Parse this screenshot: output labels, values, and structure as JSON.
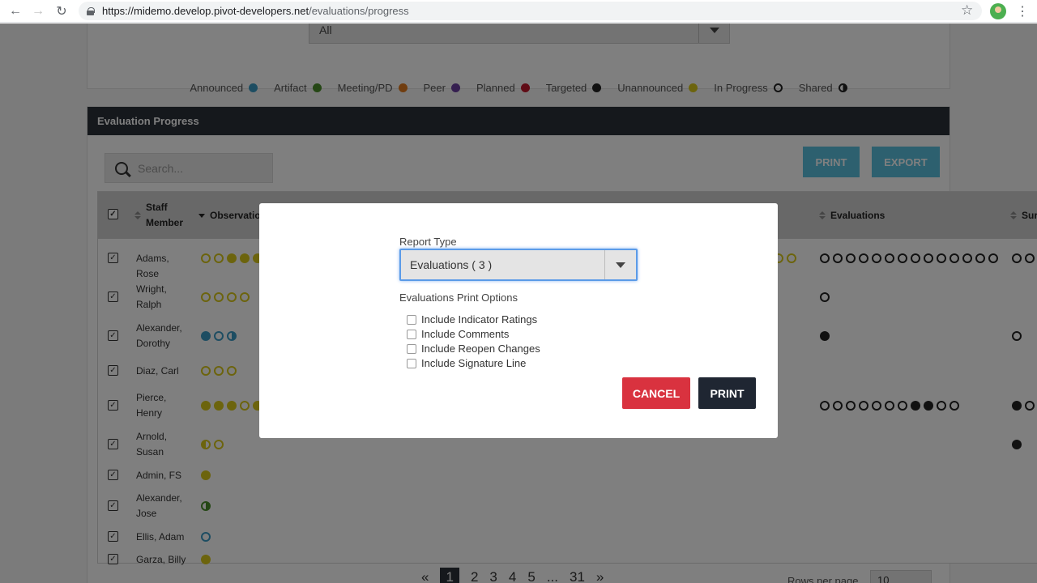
{
  "browser": {
    "url_host": "https://midemo.develop.pivot-developers.net",
    "url_path": "/evaluations/progress",
    "back_icon": "←",
    "forward_icon": "→",
    "reload_icon": "↻",
    "star_icon": "☆",
    "menu_icon": "⋮"
  },
  "filter": {
    "selected": "All"
  },
  "legend": [
    {
      "label": "Announced",
      "color": "#3b9bc4",
      "style": "filled"
    },
    {
      "label": "Artifact",
      "color": "#4a8f2a",
      "style": "filled"
    },
    {
      "label": "Meeting/PD",
      "color": "#e07b1f",
      "style": "filled"
    },
    {
      "label": "Peer",
      "color": "#6b3fa0",
      "style": "filled"
    },
    {
      "label": "Planned",
      "color": "#c0182d",
      "style": "filled"
    },
    {
      "label": "Targeted",
      "color": "#222222",
      "style": "filled"
    },
    {
      "label": "Unannounced",
      "color": "#d9c81a",
      "style": "filled"
    },
    {
      "label": "In Progress",
      "color": "#222222",
      "style": "ring"
    },
    {
      "label": "Shared",
      "color": "#222222",
      "style": "half"
    }
  ],
  "panel": {
    "title": "Evaluation Progress",
    "search_placeholder": "Search...",
    "print_label": "PRINT",
    "export_label": "EXPORT"
  },
  "table": {
    "headers": {
      "staff": "Staff Member",
      "observations": "Observatio",
      "evaluations": "Evaluations",
      "surveys": "Sur"
    },
    "rows": [
      {
        "name": "Adams, Rose",
        "obs": [
          "yo",
          "yo",
          "y",
          "y",
          "y"
        ],
        "obs_right": [
          "yo",
          "yo"
        ],
        "evals": [
          "ko",
          "ko",
          "ko",
          "ko",
          "ko",
          "ko",
          "ko",
          "ko",
          "ko",
          "ko",
          "ko",
          "ko",
          "ko",
          "ko"
        ],
        "sur": [
          "ko",
          "ko"
        ]
      },
      {
        "name": "Wright, Ralph",
        "obs": [
          "yo",
          "yo",
          "yo",
          "yo"
        ],
        "evals": [
          "ko"
        ],
        "sur": []
      },
      {
        "name": "Alexander, Dorothy",
        "obs": [
          "b",
          "bo",
          "bh"
        ],
        "evals": [
          "k"
        ],
        "sur": [
          "ko"
        ]
      },
      {
        "name": "Diaz, Carl",
        "obs": [
          "yo",
          "yo",
          "yo"
        ],
        "evals": [],
        "sur": []
      },
      {
        "name": "Pierce, Henry",
        "obs": [
          "y",
          "y",
          "y",
          "yo",
          "y"
        ],
        "evals": [
          "ko",
          "ko",
          "ko",
          "ko",
          "ko",
          "ko",
          "ko",
          "k",
          "k",
          "ko",
          "ko"
        ],
        "sur": [
          "k",
          "ko"
        ]
      },
      {
        "name": "Arnold, Susan",
        "obs": [
          "yh",
          "yo"
        ],
        "evals": [],
        "sur": [
          "k"
        ]
      },
      {
        "name": "Admin, FS",
        "obs": [
          "y"
        ],
        "evals": [],
        "sur": []
      },
      {
        "name": "Alexander, Jose",
        "obs": [
          "gh"
        ],
        "evals": [],
        "sur": []
      },
      {
        "name": "Ellis, Adam",
        "obs": [
          "bo"
        ],
        "evals": [],
        "sur": []
      },
      {
        "name": "Garza, Billy",
        "obs": [
          "y"
        ],
        "evals": [],
        "sur": []
      }
    ]
  },
  "pager": {
    "prev": "«",
    "pages": [
      "1",
      "2",
      "3",
      "4",
      "5"
    ],
    "ellipsis": "...",
    "last": "31",
    "next": "»",
    "rows_per_page_label": "Rows per page",
    "rows_per_page_value": "10"
  },
  "modal": {
    "report_type_label": "Report Type",
    "report_type_value": "Evaluations ( 3 )",
    "options_label": "Evaluations Print Options",
    "options": [
      {
        "label": "Include Indicator Ratings",
        "checked": false
      },
      {
        "label": "Include Comments",
        "checked": false
      },
      {
        "label": "Include Reopen Changes",
        "checked": false
      },
      {
        "label": "Include Signature Line",
        "checked": false
      }
    ],
    "cancel_label": "CANCEL",
    "print_label": "PRINT"
  }
}
